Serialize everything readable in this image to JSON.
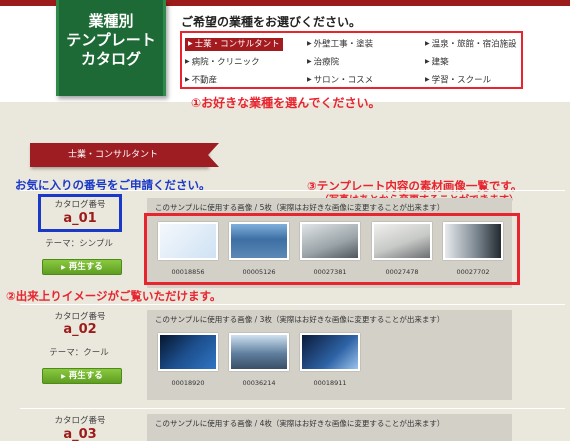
{
  "header": {
    "logo_lines": [
      "業種別",
      "テンプレート",
      "カタログ"
    ],
    "select_title": "ご希望の業種をお選びください。",
    "categories": [
      {
        "label": "士業・コンサルタント"
      },
      {
        "label": "外壁工事・塗装"
      },
      {
        "label": "温泉・旅館・宿泊施設"
      },
      {
        "label": "病院・クリニック"
      },
      {
        "label": "治療院"
      },
      {
        "label": "建築"
      },
      {
        "label": "不動産"
      },
      {
        "label": "サロン・コスメ"
      },
      {
        "label": "学習・スクール"
      }
    ],
    "selected_category": "士業・コンサルタント"
  },
  "annotations": {
    "a1": "①お好きな業種を選んでください。",
    "a2": "②出来上りイメージがご覧いただけます。",
    "a3": "③テンプレート内容の素材画像一覧です。",
    "a3_sub": "（写真はあとから変更することができます）",
    "blue": "お気に入りの番号をご申請ください。"
  },
  "section": {
    "title": "士業・コンサルタント"
  },
  "catalog_label": "カタログ番号",
  "play_label": "再生する",
  "templates": [
    {
      "number": "a_01",
      "theme": "テーマ：シンプル",
      "panel_title": "このサンプルに使用する画像 / 5枚（実際はお好きな画像に変更することが出来ます）",
      "images": [
        {
          "code": "00018856"
        },
        {
          "code": "00005126"
        },
        {
          "code": "00027381"
        },
        {
          "code": "00027478"
        },
        {
          "code": "00027702"
        }
      ]
    },
    {
      "number": "a_02",
      "theme": "テーマ：クール",
      "panel_title": "このサンプルに使用する画像 / 3枚（実際はお好きな画像に変更することが出来ます）",
      "images": [
        {
          "code": "00018920"
        },
        {
          "code": "00036214"
        },
        {
          "code": "00018911"
        }
      ]
    },
    {
      "number": "a_03",
      "panel_title": "このサンプルに使用する画像 / 4枚（実際はお好きな画像に変更することが出来ます）"
    }
  ],
  "colors": {
    "brand_red": "#9c1c1c",
    "highlight_red": "#e8242e",
    "annotation_blue": "#1a39c9",
    "logo_green": "#1e6a36",
    "play_green": "#6aae2a"
  }
}
